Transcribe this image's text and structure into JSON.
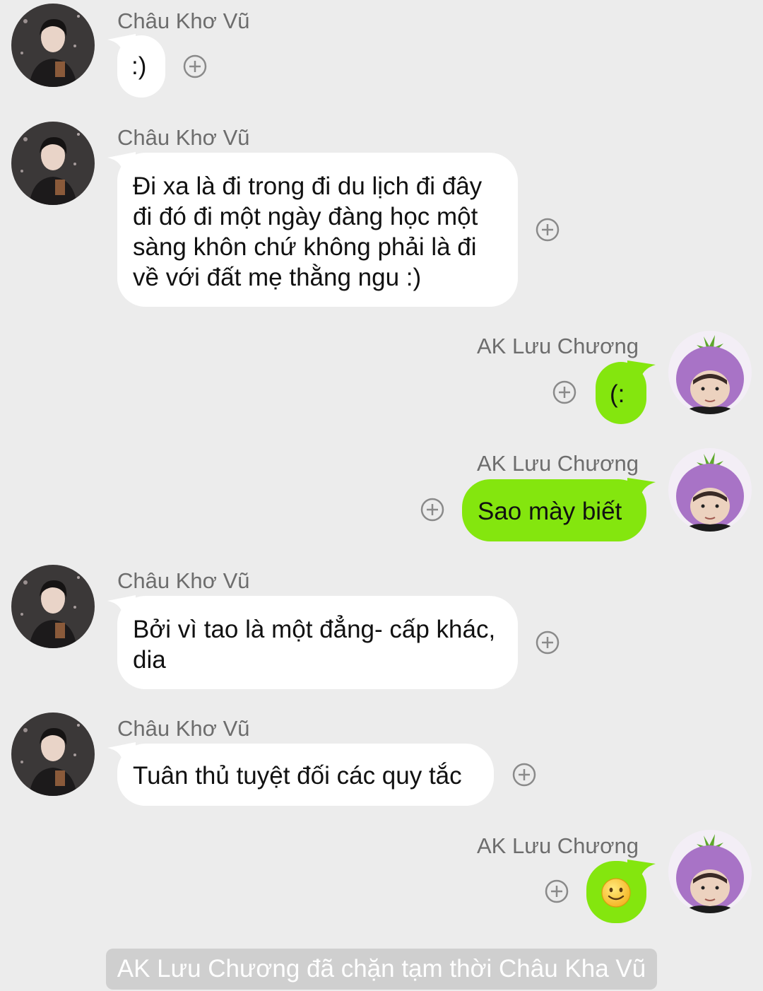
{
  "contacts": {
    "them": {
      "name": "Châu Khơ Vũ",
      "avatar_icon": "man-dark-portrait-avatar"
    },
    "me": {
      "name": "AK Lưu Chương",
      "avatar_icon": "eggplant-hat-avatar"
    }
  },
  "messages": [
    {
      "side": "in",
      "sender": "Châu Khơ Vũ",
      "lines": [
        ":)"
      ]
    },
    {
      "side": "in",
      "sender": "Châu Khơ Vũ",
      "lines": [
        "Đi xa là đi trong đi du lịch đi đây",
        "đi đó đi một ngày đàng học một",
        "sàng khôn chứ không phải là đi",
        "về với đất mẹ thằng ngu :)"
      ]
    },
    {
      "side": "out",
      "sender": "AK Lưu Chương",
      "lines": [
        "(:"
      ]
    },
    {
      "side": "out",
      "sender": "AK Lưu Chương",
      "lines": [
        "Sao mày biết"
      ]
    },
    {
      "side": "in",
      "sender": "Châu Khơ Vũ",
      "lines": [
        "Bởi vì tao là một đẳng- cấp khác,",
        "dia"
      ]
    },
    {
      "side": "in",
      "sender": "Châu Khơ Vũ",
      "lines": [
        "Tuân thủ tuyệt đối các quy tắc"
      ]
    },
    {
      "side": "out",
      "sender": "AK Lưu Chương",
      "emoji": "smiling-face-emoji"
    }
  ],
  "system_notice": "AK Lưu Chương đã chặn tạm thời Châu Kha Vũ",
  "colors": {
    "background": "#ececec",
    "incoming_bubble": "#ffffff",
    "outgoing_bubble": "#84e60e",
    "sender_text": "#6d6d6d"
  }
}
